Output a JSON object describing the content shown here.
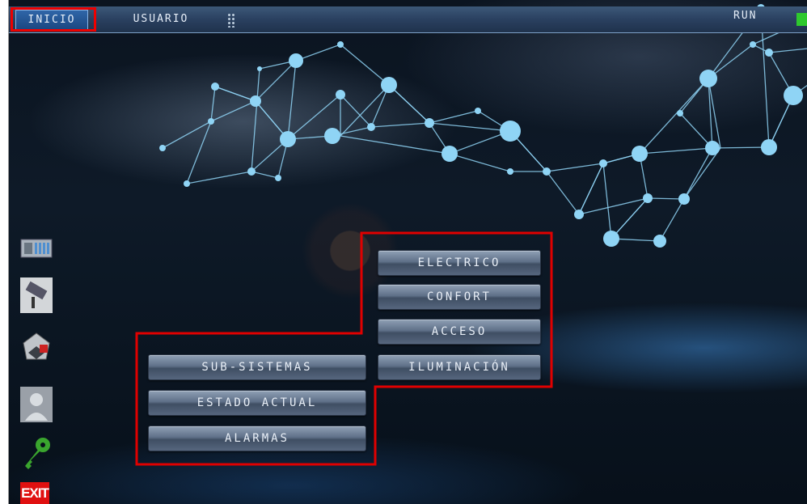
{
  "topbar": {
    "tabs": [
      {
        "label": "INICIO",
        "active": true
      },
      {
        "label": "USUARIO",
        "active": false
      }
    ],
    "run_label": "RUN",
    "run_status_color": "#2ec92e"
  },
  "sidebar": {
    "items": [
      {
        "icon": "plc-icon"
      },
      {
        "icon": "camera-icon"
      },
      {
        "icon": "home-security-icon"
      },
      {
        "icon": "user-icon"
      },
      {
        "icon": "key-icon"
      },
      {
        "icon": "exit-icon",
        "label": "EXIT"
      }
    ]
  },
  "menu": {
    "subsystem_buttons": [
      "ELECTRICO",
      "CONFORT",
      "ACCESO",
      "ILUMINACIÓN"
    ],
    "main_buttons": [
      "SUB-SISTEMAS",
      "ESTADO ACTUAL",
      "ALARMAS"
    ]
  },
  "colors": {
    "highlight": "#e00000",
    "network": "#8fd4f5",
    "accent": "#2f66a8"
  }
}
